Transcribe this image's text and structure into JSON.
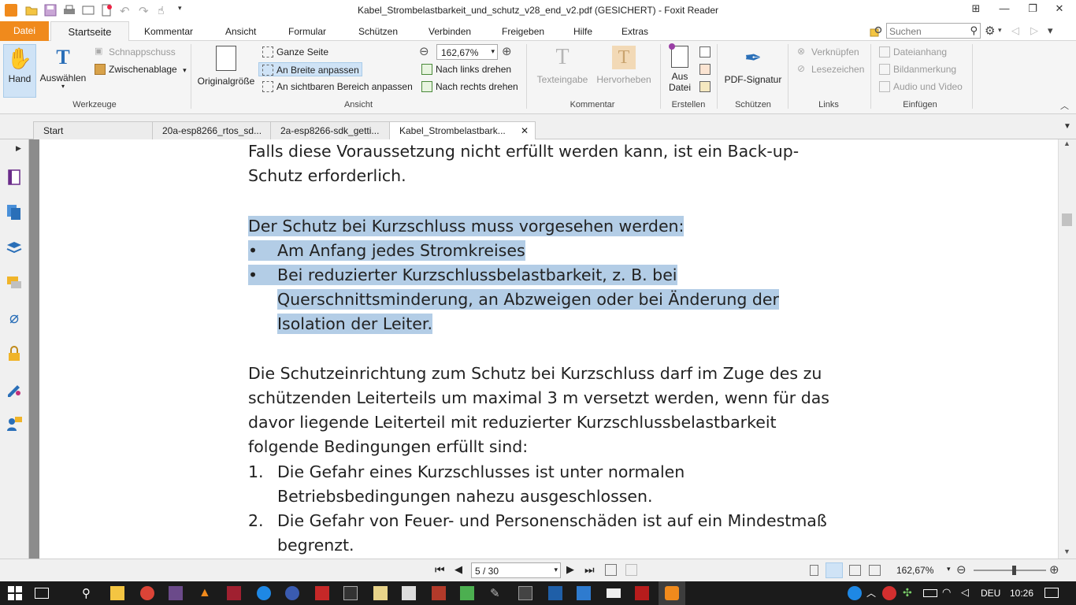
{
  "window": {
    "title": "Kabel_Strombelastbarkeit_und_schutz_v28_end_v2.pdf (GESICHERT) - Foxit Reader"
  },
  "menu": {
    "file": "Datei",
    "tabs": [
      "Startseite",
      "Kommentar",
      "Ansicht",
      "Formular",
      "Schützen",
      "Verbinden",
      "Freigeben",
      "Hilfe",
      "Extras"
    ],
    "search_placeholder": "Suchen"
  },
  "ribbon": {
    "werkzeuge": {
      "hand": "Hand",
      "auswaehlen": "Auswählen",
      "schnappschuss": "Schnappschuss",
      "zwischenablage": "Zwischenablage",
      "label": "Werkzeuge"
    },
    "ansicht": {
      "originalgroesse": "Originalgröße",
      "ganze_seite": "Ganze Seite",
      "an_breite": "An Breite anpassen",
      "sichtbaren_bereich": "An sichtbaren Bereich anpassen",
      "zoom": "162,67%",
      "links_drehen": "Nach links drehen",
      "rechts_drehen": "Nach rechts drehen",
      "label": "Ansicht"
    },
    "kommentar": {
      "texteingabe": "Texteingabe",
      "hervorheben": "Hervorheben",
      "label": "Kommentar"
    },
    "erstellen": {
      "aus_datei_1": "Aus",
      "aus_datei_2": "Datei",
      "label": "Erstellen"
    },
    "schuetzen": {
      "pdf_signatur": "PDF-Signatur",
      "label": "Schützen"
    },
    "links": {
      "verknuepfen": "Verknüpfen",
      "lesezeichen": "Lesezeichen",
      "label": "Links"
    },
    "einfuegen": {
      "dateianhang": "Dateianhang",
      "bildanmerkung": "Bildanmerkung",
      "audio_video": "Audio und Video",
      "label": "Einfügen"
    }
  },
  "doc_tabs": [
    "Start",
    "20a-esp8266_rtos_sd...",
    "2a-esp8266-sdk_getti...",
    "Kabel_Strombelastbark..."
  ],
  "document": {
    "lines": [
      "Falls diese Voraussetzung nicht erfüllt werden kann, ist ein Back-up-",
      "Schutz erforderlich.",
      "Der Schutz bei Kurzschluss muss vorgesehen werden:",
      "Am Anfang jedes Stromkreises",
      "Bei reduzierter Kurzschlussbelastbarkeit, z. B. bei",
      "Querschnittsminderung, an Abzweigen oder bei Änderung der",
      "Isolation der Leiter.",
      "Die Schutzeinrichtung zum Schutz bei Kurzschluss darf im Zuge des zu",
      "schützenden Leiterteils um maximal 3 m versetzt werden, wenn für das",
      "davor liegende Leiterteil mit reduzierter Kurzschlussbelastbarkeit",
      "folgende Bedingungen erfüllt sind:",
      "Die Gefahr eines Kurzschlusses ist unter normalen",
      "Betriebsbedingungen nahezu ausgeschlossen.",
      "Die Gefahr von Feuer- und Personenschäden ist auf ein Mindestmaß",
      "begrenzt."
    ],
    "bullet": "•",
    "num1": "1.",
    "num2": "2."
  },
  "status": {
    "page": "5 / 30",
    "zoom": "162,67%"
  },
  "taskbar": {
    "lang": "DEU",
    "time": "10:26"
  },
  "colors": {
    "accent": "#f08a1c",
    "highlight": "#b3cde6"
  }
}
